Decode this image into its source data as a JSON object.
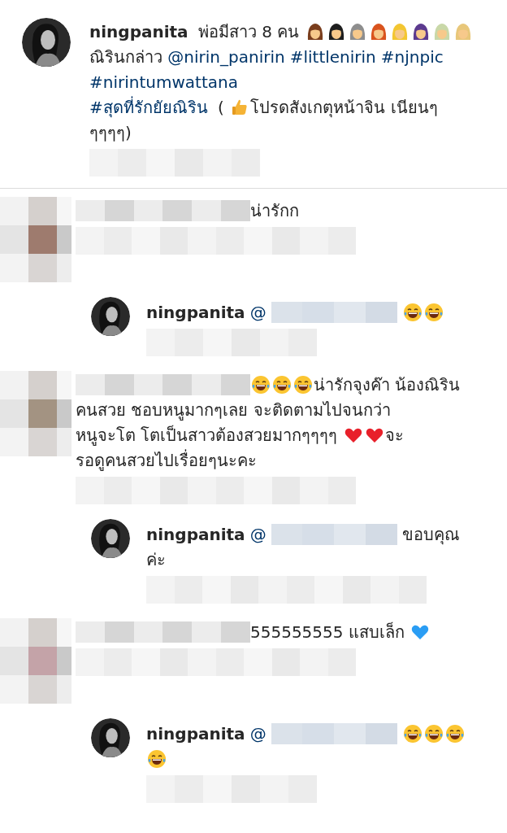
{
  "caption": {
    "lines": [
      [
        {
          "kind": "user",
          "text": "ningpanita"
        },
        {
          "kind": "text",
          "text": " พ่อมีสาว 8 คน "
        },
        {
          "kind": "woman",
          "color": "#7a3e1d"
        },
        {
          "kind": "woman",
          "color": "#1e1e1e"
        },
        {
          "kind": "woman",
          "color": "#8e8e8e"
        },
        {
          "kind": "woman",
          "color": "#d9541e"
        },
        {
          "kind": "woman",
          "color": "#f3c632"
        },
        {
          "kind": "woman",
          "color": "#5c3a8f"
        },
        {
          "kind": "woman",
          "color": "#c9d8a8"
        },
        {
          "kind": "woman",
          "color": "#e8c77a"
        }
      ],
      [
        {
          "kind": "text",
          "text": "ณิรินกล่าว "
        },
        {
          "kind": "link",
          "text": "@nirin_panirin"
        },
        {
          "kind": "link",
          "text": "#littlenirin"
        },
        {
          "kind": "link",
          "text": "#njnpic"
        }
      ],
      [
        {
          "kind": "link",
          "text": "#nirintumwattana"
        }
      ],
      [
        {
          "kind": "link",
          "text": "#สุดที่รักยัยณิริน"
        },
        {
          "kind": "text",
          "text": " ( "
        },
        {
          "kind": "thumbs"
        },
        {
          "kind": "text",
          "text": "โปรดสังเกตุหน้าจิน เนียนๆ"
        }
      ],
      [
        {
          "kind": "text",
          "text": "ๆๆๆๆ)"
        }
      ]
    ]
  },
  "comments": [
    {
      "kind": "comment",
      "color": "#9e7b6e",
      "lines": [
        [
          {
            "kind": "blur"
          },
          {
            "kind": "text",
            "text": "น่ารักก"
          }
        ]
      ]
    },
    {
      "kind": "reply",
      "lines": [
        [
          {
            "kind": "user",
            "text": "ningpanita"
          },
          {
            "kind": "link",
            "text": "@"
          },
          {
            "kind": "blur-mention"
          },
          {
            "kind": "laugh"
          },
          {
            "kind": "laugh"
          }
        ]
      ]
    },
    {
      "kind": "comment",
      "color": "#a39382",
      "lines": [
        [
          {
            "kind": "blur"
          },
          {
            "kind": "laugh"
          },
          {
            "kind": "laugh"
          },
          {
            "kind": "laugh"
          },
          {
            "kind": "text",
            "text": "น่ารักจุงค๊า น้องณิริน"
          }
        ],
        [
          {
            "kind": "text",
            "text": "คนสวย ชอบหนูมากๆเลย จะติดตามไปจนกว่า"
          }
        ],
        [
          {
            "kind": "text",
            "text": "หนูจะโต โตเป็นสาวต้องสวยมากๆๆๆๆ "
          },
          {
            "kind": "heart",
            "color": "#e8202a"
          },
          {
            "kind": "heart",
            "color": "#e8202a"
          },
          {
            "kind": "text",
            "text": "จะ"
          }
        ],
        [
          {
            "kind": "text",
            "text": "รอดูคนสวยไปเรื่อยๆนะคะ"
          }
        ]
      ]
    },
    {
      "kind": "reply",
      "lines": [
        [
          {
            "kind": "user",
            "text": "ningpanita"
          },
          {
            "kind": "link",
            "text": "@"
          },
          {
            "kind": "blur-mention"
          },
          {
            "kind": "text",
            "text": " ขอบคุณ"
          }
        ],
        [
          {
            "kind": "text",
            "text": "ค่ะ"
          }
        ]
      ]
    },
    {
      "kind": "comment",
      "color": "#c4a3a8",
      "lines": [
        [
          {
            "kind": "blur"
          },
          {
            "kind": "text",
            "text": "555555555 แสบเล็ก "
          },
          {
            "kind": "heart",
            "color": "#2a9df4"
          }
        ]
      ]
    },
    {
      "kind": "reply",
      "lines": [
        [
          {
            "kind": "user",
            "text": "ningpanita"
          },
          {
            "kind": "link",
            "text": "@"
          },
          {
            "kind": "blur-mention"
          },
          {
            "kind": "laugh"
          },
          {
            "kind": "laugh"
          },
          {
            "kind": "laugh"
          }
        ],
        [
          {
            "kind": "laugh"
          }
        ]
      ]
    }
  ]
}
